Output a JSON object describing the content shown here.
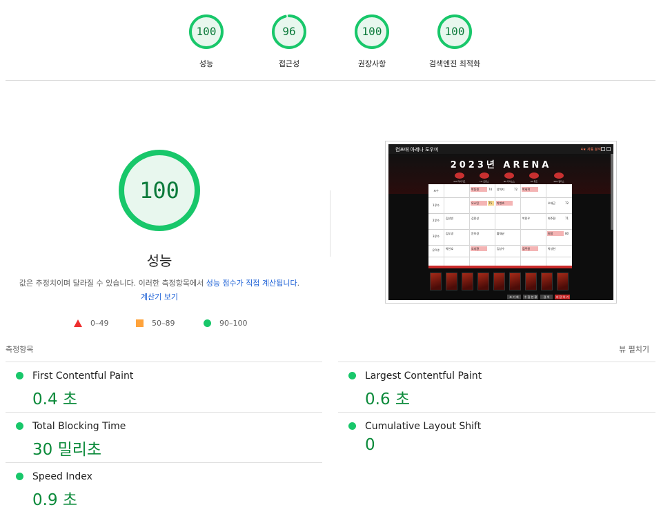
{
  "top_scores": [
    {
      "label": "성능",
      "score": "100",
      "value": 100
    },
    {
      "label": "접근성",
      "score": "96",
      "value": 96
    },
    {
      "label": "권장사항",
      "score": "100",
      "value": 100
    },
    {
      "label": "검색엔진 최적화",
      "score": "100",
      "value": 100
    }
  ],
  "main": {
    "score": "100",
    "score_value": 100,
    "title": "성능",
    "desc_prefix": "값은 추정치이며 달라질 수 있습니다. 이러한 측정항목에서 ",
    "desc_link": "성능 점수가 직접 계산됩니다",
    "desc_suffix": ". ",
    "calc_link": "계산기 보기"
  },
  "legend": [
    {
      "shape": "triangle",
      "range": "0–49",
      "color": "#ee2f2f"
    },
    {
      "shape": "square",
      "range": "50–89",
      "color": "#ffa33b"
    },
    {
      "shape": "circle",
      "range": "90–100",
      "color": "#18c76a"
    }
  ],
  "metrics_header": "측정항목",
  "expand_label": "뷰 펼치기",
  "metrics": [
    {
      "name": "First Contentful Paint",
      "value": "0.4 초"
    },
    {
      "name": "Largest Contentful Paint",
      "value": "0.6 초"
    },
    {
      "name": "Total Blocking Time",
      "value": "30 밀리초"
    },
    {
      "name": "Cumulative Layout Shift",
      "value": "0"
    },
    {
      "name": "Speed Index",
      "value": "0.9 초"
    }
  ],
  "thumbnail": {
    "app_name": "컴프매 아레나 도우미",
    "tools_label": "4★ 자동 분석",
    "title": "2023년 ARENA",
    "teams": [
      "KIA 타이거즈",
      "LG 트윈스",
      "NC 다이노스",
      "KT 위즈",
      "SSG 랜더스"
    ],
    "positions": [
      "포수",
      "1루수",
      "2루수",
      "3루수",
      "유격수"
    ],
    "cells": [
      {
        "text": "박동원",
        "style": "pink"
      },
      {
        "text": "74",
        "style": ""
      },
      {
        "text": "양의지",
        "style": ""
      },
      {
        "text": "72",
        "style": ""
      },
      {
        "text": "박세혁",
        "style": "pink"
      },
      {
        "text": "오스틴",
        "style": "pink"
      },
      {
        "text": "75",
        "style": "yel"
      },
      {
        "text": "박병호",
        "style": "pink"
      },
      {
        "text": "오태곤",
        "style": ""
      },
      {
        "text": "72",
        "style": ""
      },
      {
        "text": "김선빈",
        "style": ""
      },
      {
        "text": "김민성",
        "style": ""
      },
      {
        "text": "박민우",
        "style": ""
      },
      {
        "text": "최주환",
        "style": ""
      },
      {
        "text": "71",
        "style": ""
      },
      {
        "text": "김도영",
        "style": ""
      },
      {
        "text": "문보경",
        "style": ""
      },
      {
        "text": "황재균",
        "style": ""
      },
      {
        "text": "최정",
        "style": "pink"
      },
      {
        "text": "80",
        "style": ""
      },
      {
        "text": "박찬호",
        "style": ""
      },
      {
        "text": "오지환",
        "style": "pink"
      },
      {
        "text": "김상수",
        "style": ""
      },
      {
        "text": "김주원",
        "style": "pink"
      },
      {
        "text": "박성한",
        "style": ""
      }
    ],
    "buttons": [
      "초 기 화",
      "수 집 현 황",
      "검 색",
      "저 장 하 기"
    ]
  }
}
